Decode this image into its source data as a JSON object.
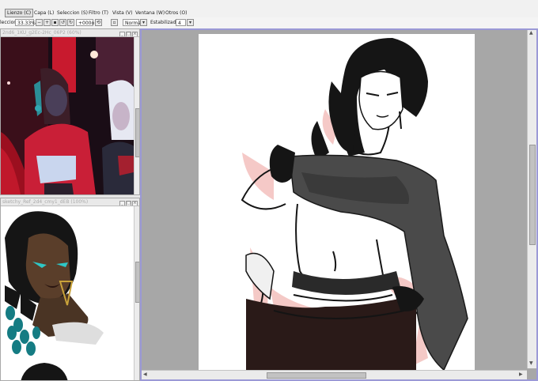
{
  "menu": {
    "items": [
      "Lienzo (C)",
      "Capa (L)",
      "Seleccion (S)",
      "Filtro (T)",
      "Vista (V)",
      "Ventana (W)",
      "Otros (O)"
    ]
  },
  "toolbar": {
    "selection_label": "leccion",
    "zoom_value": "33.33%",
    "rotation_value": "+000o",
    "blend_mode": "Normal",
    "stabilizer_label": "Estabilizador",
    "stabilizer_value": "4"
  },
  "panels": {
    "reference_top_title": "2nd6_1KU_g2Ec-2Hc_06P2 (60%)",
    "reference_bottom_title": "sketchy_Ref_2d4_cmy1_dEB (100%)"
  },
  "colors": {
    "canvas_border": "#9b99d6",
    "canvas_bg": "#a7a7a7",
    "hair": "#1a1a1a",
    "scarf": "#4a4a4a",
    "skin_shade": "#f2b8b4",
    "ref_red": "#b8142a",
    "ref_teal": "#1fa3a8"
  },
  "icons": [
    "zoom-out-icon",
    "zoom-in-icon",
    "rotate-icon",
    "scroll-up-arrow-icon",
    "scroll-down-arrow-icon",
    "scroll-left-arrow-icon",
    "scroll-right-arrow-icon"
  ]
}
